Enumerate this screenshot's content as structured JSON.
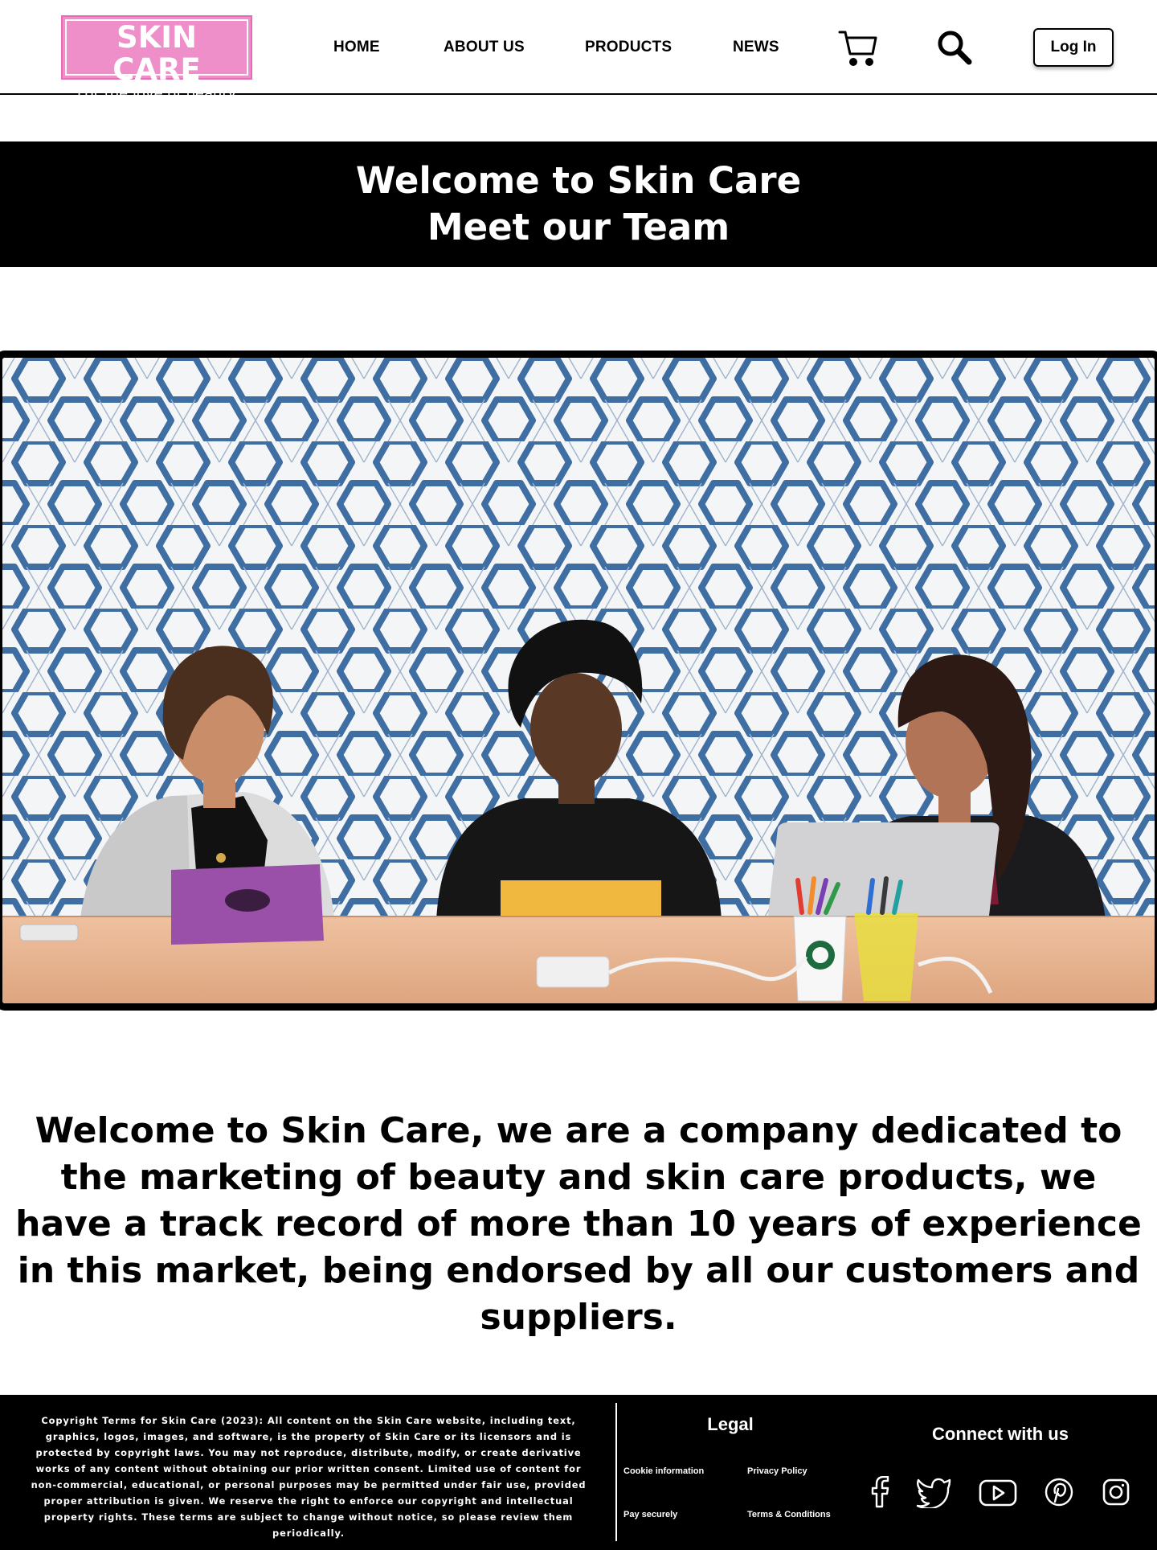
{
  "header": {
    "logo": {
      "title": "SKIN CARE",
      "subtitle": "For the love of beauty"
    },
    "nav": {
      "home": "HOME",
      "about": "ABOUT US",
      "products": "PRODUCTS",
      "news": "NEWS"
    },
    "icons": {
      "cart": "cart-icon",
      "search": "search-icon"
    },
    "login_label": "Log In"
  },
  "hero": {
    "line1": "Welcome to Skin Care",
    "line2": "Meet our Team"
  },
  "team_photo": {
    "colors": {
      "wall": "#f4f5f7",
      "hexagon": "#3f6ea3",
      "table": "#e9b48f"
    }
  },
  "intro": {
    "text": "Welcome to Skin Care, we are a company dedicated to the marketing of beauty and skin care products, we have a track record of more than 10 years of experience in this market, being endorsed by all our customers and suppliers."
  },
  "footer": {
    "copyright": "Copyright Terms for Skin Care (2023): All content on the Skin Care website, including text, graphics, logos, images, and software, is the property of Skin Care or its licensors and is protected by copyright laws. You may not reproduce, distribute, modify, or create derivative works of any content without obtaining our prior written consent. Limited use of content for non-commercial, educational, or personal purposes may be permitted under fair use, provided proper attribution is given. We reserve the right to enforce our copyright and intellectual property rights. These terms are subject to change without notice, so please review them periodically.",
    "legal": {
      "title": "Legal",
      "cookie": "Cookie information",
      "privacy": "Privacy  Policy",
      "pay": "Pay securely",
      "terms": "Terms & Conditions"
    },
    "connect": {
      "title": "Connect with us",
      "icons": [
        "facebook-icon",
        "twitter-icon",
        "youtube-icon",
        "pinterest-icon",
        "instagram-icon"
      ]
    }
  },
  "colors": {
    "brand_pink": "#ee8fc9",
    "black": "#000000",
    "white": "#ffffff"
  }
}
